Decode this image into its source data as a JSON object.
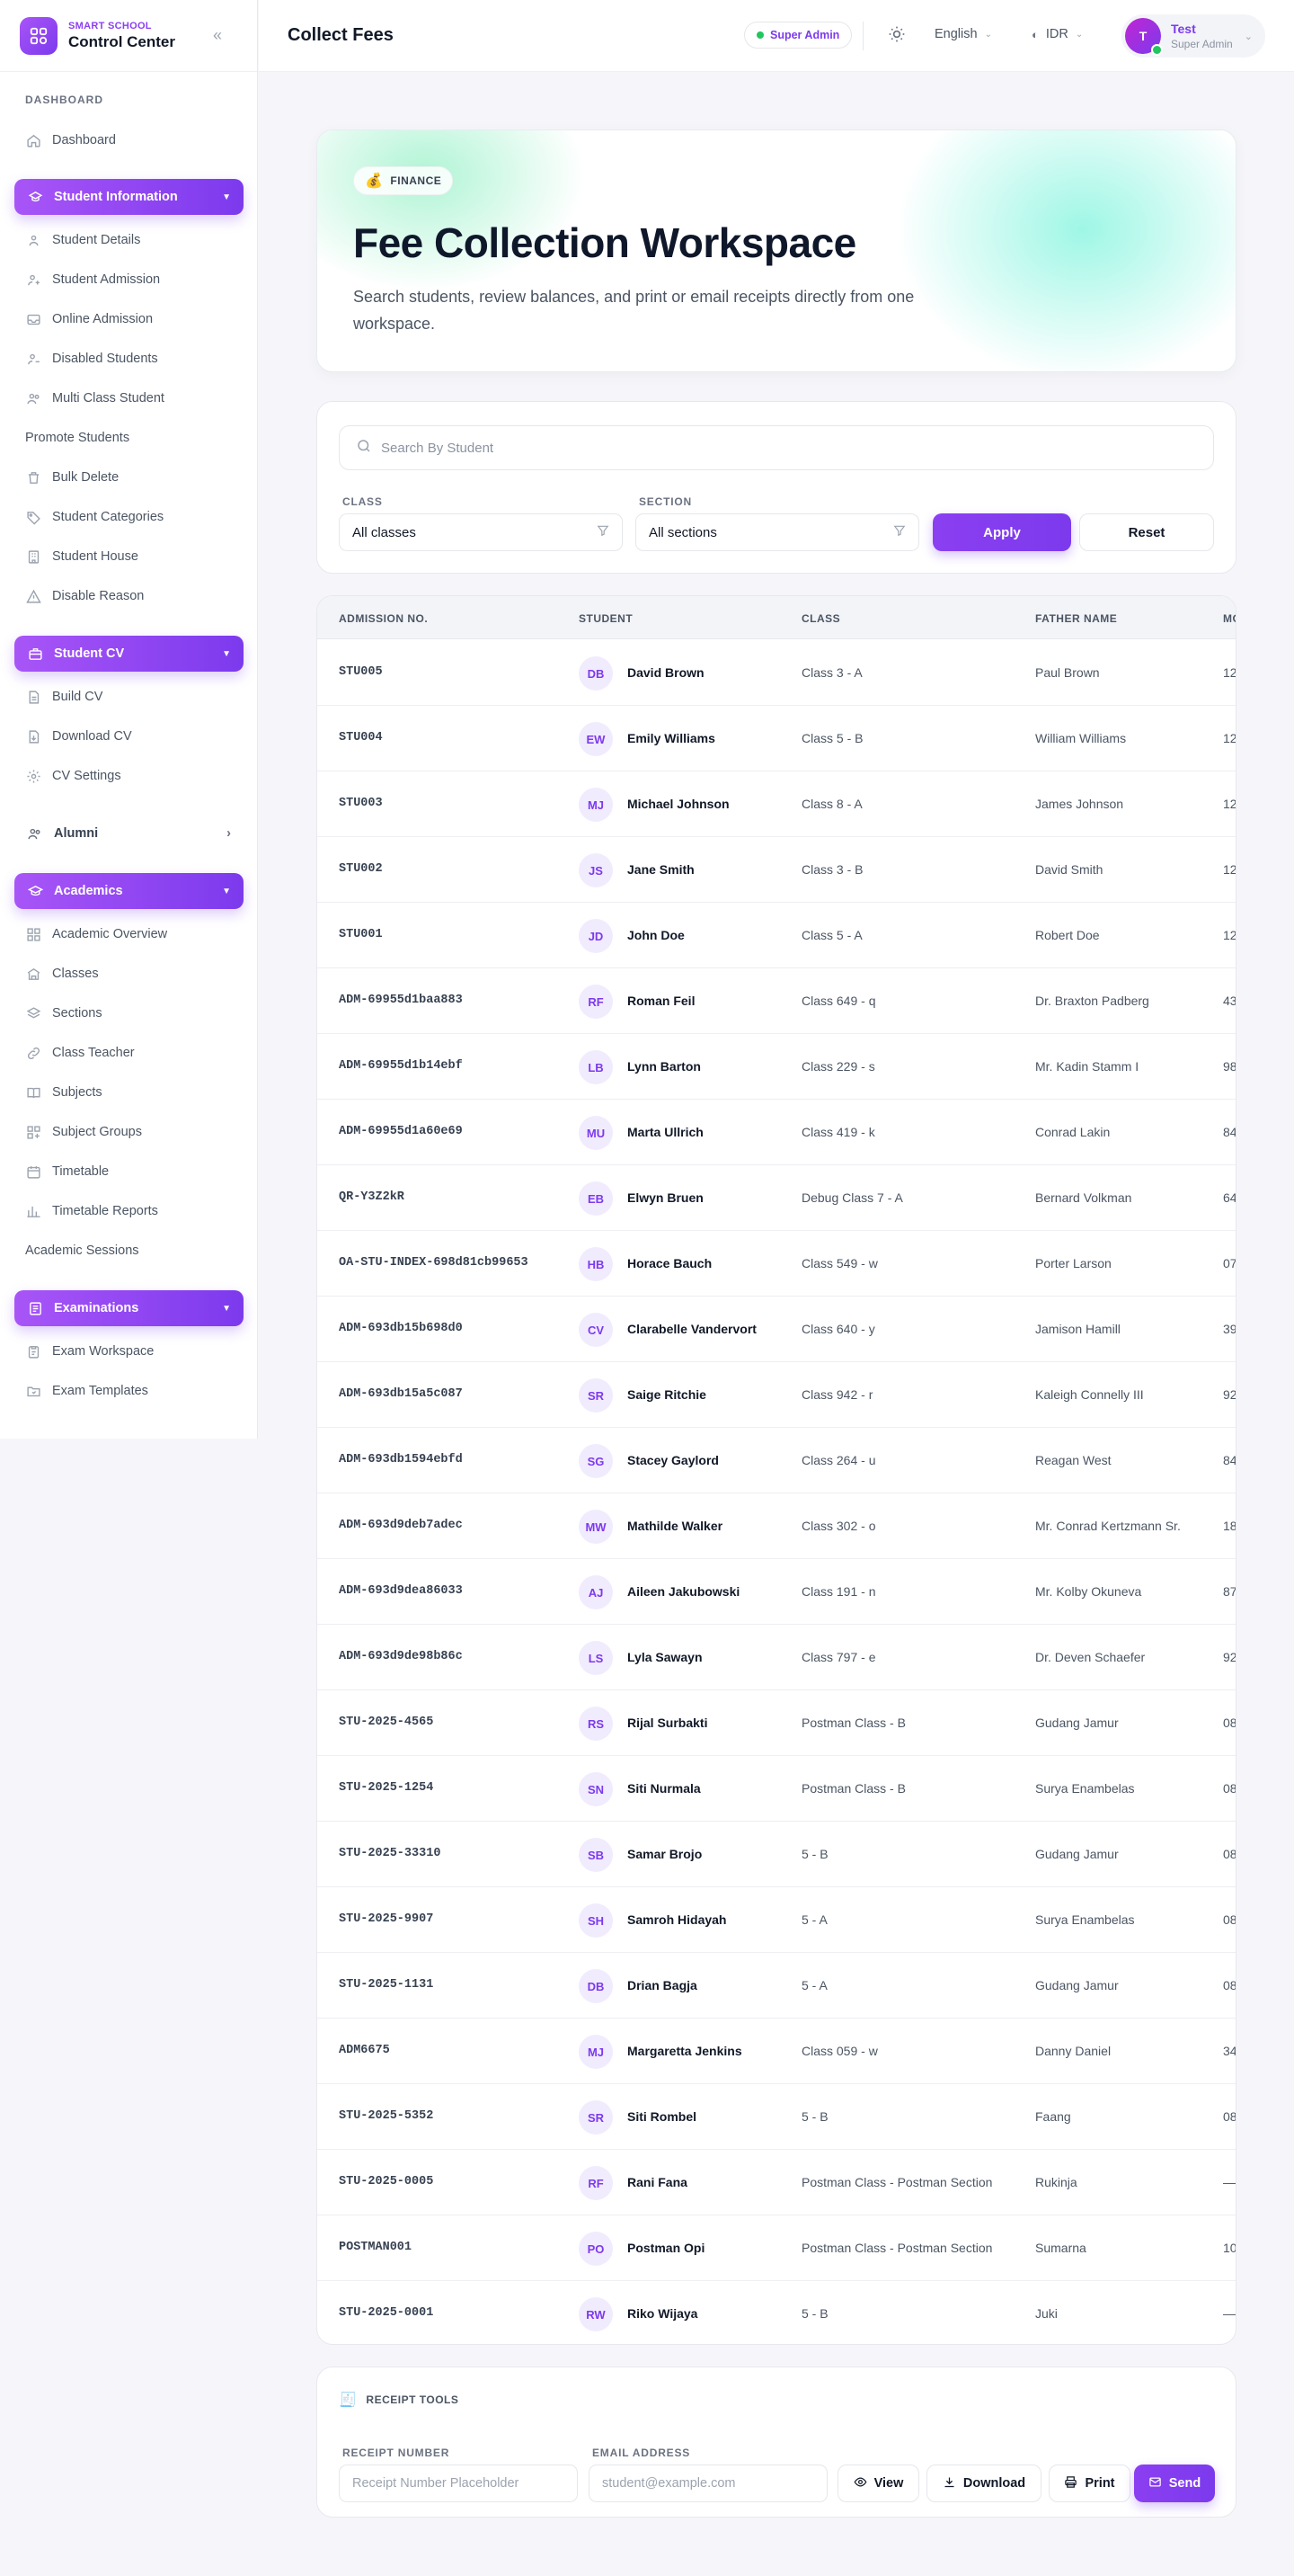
{
  "brand": {
    "subtitle": "SMART SCHOOL",
    "title": "Control Center"
  },
  "sidebar": {
    "section_dashboard": "DASHBOARD",
    "dashboard": "Dashboard",
    "student_information": "Student Information",
    "student_info_items": [
      "Student Details",
      "Student Admission",
      "Online Admission",
      "Disabled Students",
      "Multi Class Student"
    ],
    "promote_students": "Promote Students",
    "student_info_items2": [
      "Bulk Delete",
      "Student Categories",
      "Student House",
      "Disable Reason"
    ],
    "student_cv": "Student CV",
    "cv_items": [
      "Build CV",
      "Download CV",
      "CV Settings"
    ],
    "alumni": "Alumni",
    "academics": "Academics",
    "academic_items": [
      "Academic Overview",
      "Classes",
      "Sections",
      "Class Teacher",
      "Subjects",
      "Subject Groups",
      "Timetable",
      "Timetable Reports"
    ],
    "academic_sessions": "Academic Sessions",
    "examinations": "Examinations",
    "exam_items": [
      "Exam Workspace",
      "Exam Templates"
    ]
  },
  "header": {
    "title": "Collect Fees",
    "role_badge": "Super Admin",
    "language": "English",
    "currency": "IDR",
    "user_initial": "T",
    "user_name": "Test",
    "user_role": "Super Admin"
  },
  "hero": {
    "chip": "FINANCE",
    "chip_emoji": "💰",
    "title": "Fee Collection Workspace",
    "description": "Search students, review balances, and print or email receipts directly from one workspace."
  },
  "filters": {
    "search_placeholder": "Search By Student",
    "class_label": "CLASS",
    "class_value": "All classes",
    "section_label": "SECTION",
    "section_value": "All sections",
    "apply": "Apply",
    "reset": "Reset"
  },
  "table": {
    "headers": [
      "ADMISSION NO.",
      "STUDENT",
      "CLASS",
      "FATHER NAME",
      "MO"
    ],
    "rows": [
      {
        "adm": "STU005",
        "initials": "DB",
        "name": "David Brown",
        "class": "Class 3 - A",
        "father": "Paul Brown",
        "mo": "12"
      },
      {
        "adm": "STU004",
        "initials": "EW",
        "name": "Emily Williams",
        "class": "Class 5 - B",
        "father": "William Williams",
        "mo": "12"
      },
      {
        "adm": "STU003",
        "initials": "MJ",
        "name": "Michael Johnson",
        "class": "Class 8 - A",
        "father": "James Johnson",
        "mo": "12"
      },
      {
        "adm": "STU002",
        "initials": "JS",
        "name": "Jane Smith",
        "class": "Class 3 - B",
        "father": "David Smith",
        "mo": "12"
      },
      {
        "adm": "STU001",
        "initials": "JD",
        "name": "John Doe",
        "class": "Class 5 - A",
        "father": "Robert Doe",
        "mo": "12"
      },
      {
        "adm": "ADM-69955d1baa883",
        "initials": "RF",
        "name": "Roman Feil",
        "class": "Class 649 - q",
        "father": "Dr. Braxton Padberg",
        "mo": "43"
      },
      {
        "adm": "ADM-69955d1b14ebf",
        "initials": "LB",
        "name": "Lynn Barton",
        "class": "Class 229 - s",
        "father": "Mr. Kadin Stamm I",
        "mo": "98"
      },
      {
        "adm": "ADM-69955d1a60e69",
        "initials": "MU",
        "name": "Marta Ullrich",
        "class": "Class 419 - k",
        "father": "Conrad Lakin",
        "mo": "84"
      },
      {
        "adm": "QR-Y3Z2kR",
        "initials": "EB",
        "name": "Elwyn Bruen",
        "class": "Debug Class 7 - A",
        "father": "Bernard Volkman",
        "mo": "64"
      },
      {
        "adm": "OA-STU-INDEX-698d81cb99653",
        "initials": "HB",
        "name": "Horace Bauch",
        "class": "Class 549 - w",
        "father": "Porter Larson",
        "mo": "07"
      },
      {
        "adm": "ADM-693db15b698d0",
        "initials": "CV",
        "name": "Clarabelle Vandervort",
        "class": "Class 640 - y",
        "father": "Jamison Hamill",
        "mo": "39"
      },
      {
        "adm": "ADM-693db15a5c087",
        "initials": "SR",
        "name": "Saige Ritchie",
        "class": "Class 942 - r",
        "father": "Kaleigh Connelly III",
        "mo": "92"
      },
      {
        "adm": "ADM-693db1594ebfd",
        "initials": "SG",
        "name": "Stacey Gaylord",
        "class": "Class 264 - u",
        "father": "Reagan West",
        "mo": "84"
      },
      {
        "adm": "ADM-693d9deb7adec",
        "initials": "MW",
        "name": "Mathilde Walker",
        "class": "Class 302 - o",
        "father": "Mr. Conrad Kertzmann Sr.",
        "mo": "18"
      },
      {
        "adm": "ADM-693d9dea86033",
        "initials": "AJ",
        "name": "Aileen Jakubowski",
        "class": "Class 191 - n",
        "father": "Mr. Kolby Okuneva",
        "mo": "87"
      },
      {
        "adm": "ADM-693d9de98b86c",
        "initials": "LS",
        "name": "Lyla Sawayn",
        "class": "Class 797 - e",
        "father": "Dr. Deven Schaefer",
        "mo": "92"
      },
      {
        "adm": "STU-2025-4565",
        "initials": "RS",
        "name": "Rijal Surbakti",
        "class": "Postman Class - B",
        "father": "Gudang Jamur",
        "mo": "08"
      },
      {
        "adm": "STU-2025-1254",
        "initials": "SN",
        "name": "Siti Nurmala",
        "class": "Postman Class - B",
        "father": "Surya Enambelas",
        "mo": "08"
      },
      {
        "adm": "STU-2025-33310",
        "initials": "SB",
        "name": "Samar Brojo",
        "class": "5 - B",
        "father": "Gudang Jamur",
        "mo": "08"
      },
      {
        "adm": "STU-2025-9907",
        "initials": "SH",
        "name": "Samroh Hidayah",
        "class": "5 - A",
        "father": "Surya Enambelas",
        "mo": "08"
      },
      {
        "adm": "STU-2025-1131",
        "initials": "DB",
        "name": "Drian Bagja",
        "class": "5 - A",
        "father": "Gudang Jamur",
        "mo": "08"
      },
      {
        "adm": "ADM6675",
        "initials": "MJ",
        "name": "Margaretta Jenkins",
        "class": "Class 059 - w",
        "father": "Danny Daniel",
        "mo": "34"
      },
      {
        "adm": "STU-2025-5352",
        "initials": "SR",
        "name": "Siti Rombel",
        "class": "5 - B",
        "father": "Faang",
        "mo": "08"
      },
      {
        "adm": "STU-2025-0005",
        "initials": "RF",
        "name": "Rani Fana",
        "class": "Postman Class - Postman Section",
        "father": "Rukinja",
        "mo": "—"
      },
      {
        "adm": "POSTMAN001",
        "initials": "PO",
        "name": "Postman Opi",
        "class": "Postman Class - Postman Section",
        "father": "Sumarna",
        "mo": "10"
      },
      {
        "adm": "STU-2025-0001",
        "initials": "RW",
        "name": "Riko Wijaya",
        "class": "5 - B",
        "father": "Juki",
        "mo": "—"
      }
    ]
  },
  "receipt": {
    "heading": "RECEIPT TOOLS",
    "heading_emoji": "🧾",
    "receipt_label": "RECEIPT NUMBER",
    "receipt_placeholder": "Receipt Number Placeholder",
    "email_label": "EMAIL ADDRESS",
    "email_placeholder": "student@example.com",
    "view": "View",
    "download": "Download",
    "print": "Print",
    "send": "Send"
  },
  "colors": {
    "accent": "#7c3aed",
    "accent_light": "#a855f7",
    "online": "#22c55e"
  }
}
